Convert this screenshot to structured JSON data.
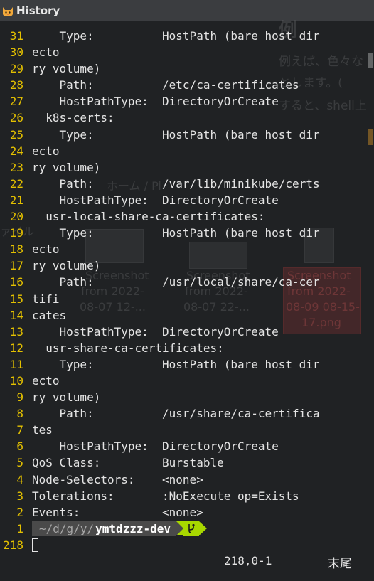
{
  "window": {
    "title": "History",
    "icon": "cat-icon"
  },
  "background_window": {
    "heading": "例",
    "text1": "例えば、色々な",
    "text2": "とします。(",
    "text3": "すると、shell上",
    "breadcrumb": "ホーム / Pi",
    "sidebar": "ァイル",
    "thumb1_l1": "Screenshot",
    "thumb1_l2": "from 2022-",
    "thumb1_l3": "08-07 12-...",
    "thumb2_l1": "Screenshot",
    "thumb2_l2": "from 2022-",
    "thumb2_l3": "08-07 22-...",
    "thumb3_l1": "Screenshot",
    "thumb3_l2": "from 2022-",
    "thumb3_l3": "08-09 08-15-",
    "thumb3_l4": "17.png"
  },
  "lines": [
    {
      "num": "31",
      "text": "    Type:          HostPath (bare host dir"
    },
    {
      "num": "30",
      "text": "ecto"
    },
    {
      "num": "29",
      "text": "ry volume)"
    },
    {
      "num": "28",
      "text": "    Path:          /etc/ca-certificates"
    },
    {
      "num": "27",
      "text": "    HostPathType:  DirectoryOrCreate"
    },
    {
      "num": "26",
      "text": "  k8s-certs:"
    },
    {
      "num": "25",
      "text": "    Type:          HostPath (bare host dir"
    },
    {
      "num": "24",
      "text": "ecto"
    },
    {
      "num": "23",
      "text": "ry volume)"
    },
    {
      "num": "22",
      "text": "    Path:          /var/lib/minikube/certs"
    },
    {
      "num": "21",
      "text": "    HostPathType:  DirectoryOrCreate"
    },
    {
      "num": "20",
      "text": "  usr-local-share-ca-certificates:"
    },
    {
      "num": "19",
      "text": "    Type:          HostPath (bare host dir"
    },
    {
      "num": "18",
      "text": "ecto"
    },
    {
      "num": "17",
      "text": "ry volume)"
    },
    {
      "num": "16",
      "text": "    Path:          /usr/local/share/ca-cer"
    },
    {
      "num": "15",
      "text": "tifi"
    },
    {
      "num": "14",
      "text": "cates"
    },
    {
      "num": "13",
      "text": "    HostPathType:  DirectoryOrCreate"
    },
    {
      "num": "12",
      "text": "  usr-share-ca-certificates:"
    },
    {
      "num": "11",
      "text": "    Type:          HostPath (bare host dir"
    },
    {
      "num": "10",
      "text": "ecto"
    },
    {
      "num": "9",
      "text": "ry volume)"
    },
    {
      "num": "8",
      "text": "    Path:          /usr/share/ca-certifica"
    },
    {
      "num": "7",
      "text": "tes"
    },
    {
      "num": "6",
      "text": "    HostPathType:  DirectoryOrCreate"
    },
    {
      "num": "5",
      "text": "QoS Class:         Burstable"
    },
    {
      "num": "4",
      "text": "Node-Selectors:    <none>"
    },
    {
      "num": "3",
      "text": "Tolerations:       :NoExecute op=Exists"
    },
    {
      "num": "2",
      "text": "Events:            <none>"
    }
  ],
  "prompt_line": {
    "num": "1",
    "path": "~/d/g/y/",
    "host": "ymtdzzz-dev",
    "git_icon": "git-branch-icon"
  },
  "current_line": {
    "num": "218"
  },
  "status": {
    "position": "218,0-1",
    "location": "末尾"
  },
  "colors": {
    "line_number": "#e3c000",
    "text": "#e4e4e4",
    "background": "#202224",
    "prompt_path_bg": "#4a4a4a",
    "prompt_git_bg": "#a8d800"
  }
}
